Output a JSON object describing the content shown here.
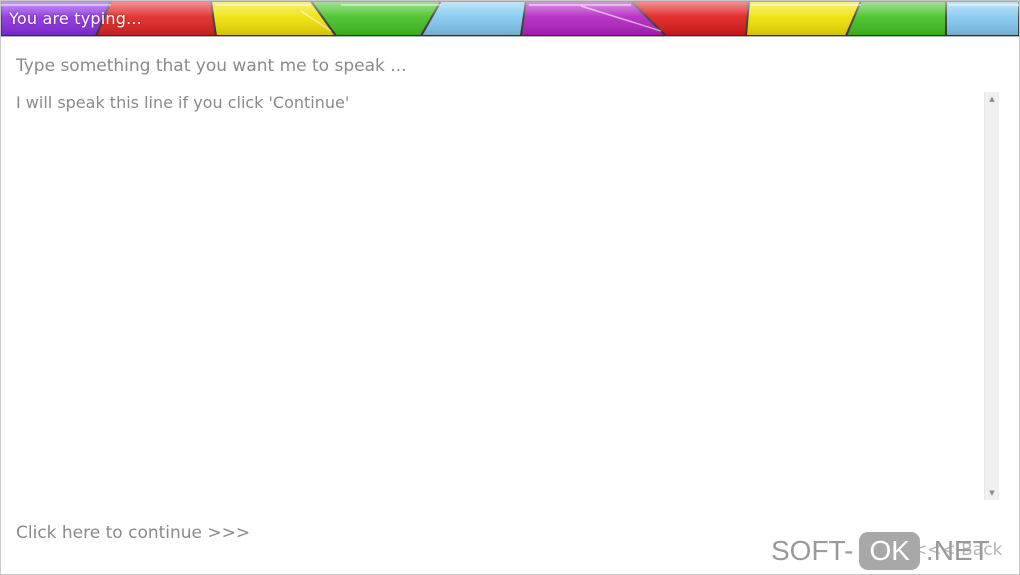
{
  "banner": {
    "title": "You are typing...",
    "colors": [
      "#8a2be2",
      "#e02020",
      "#f0e000",
      "#40c020",
      "#80c8f0",
      "#b020c0",
      "#e01818",
      "#f0e000",
      "#40c020",
      "#80c8f0"
    ]
  },
  "prompt": "Type something that you want me to speak ...",
  "textarea": {
    "value": "I will speak this line if you click 'Continue'",
    "scroll_up_icon": "triangle-up",
    "scroll_down_icon": "triangle-down"
  },
  "footer": {
    "continue_label": "Click here to continue >>>",
    "back_label": "<<< Back"
  },
  "watermark": {
    "part1": "SOFT-",
    "part2": "OK",
    "part3": ".NET"
  }
}
